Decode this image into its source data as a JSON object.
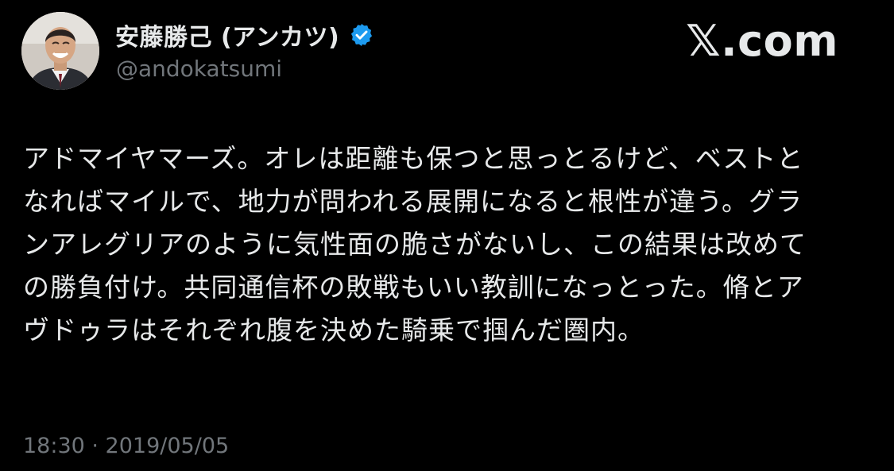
{
  "author": {
    "display_name": "安藤勝己 (アンカツ)",
    "handle": "@andokatsumi",
    "verified": true,
    "verified_color": "#1d9bf0"
  },
  "brand": {
    "label": "𝕏.com"
  },
  "tweet": {
    "lines": [
      "アドマイヤマーズ。オレは距離も保つと思っとるけど、ベストと",
      "なればマイルで、地力が問われる展開になると根性が違う。グラ",
      "ンアレグリアのように気性面の脆さがないし、この結果は改めて",
      "の勝負付け。共同通信杯の敗戦もいい教訓になっとった。脩とア",
      "ヴドゥラはそれぞれ腹を決めた騎乗で掴んだ圏内。"
    ]
  },
  "meta": {
    "timestamp": "18:30 · 2019/05/05"
  },
  "colors": {
    "background": "#000000",
    "text": "#e7e9ea",
    "secondary": "#71767b"
  },
  "icons": {
    "avatar": "profile-photo",
    "verified": "verified-badge-icon"
  }
}
